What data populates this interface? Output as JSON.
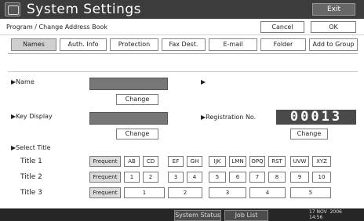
{
  "window": {
    "title": "System Settings",
    "exit_label": "Exit"
  },
  "header": {
    "breadcrumb": "Program / Change Address Book",
    "cancel_label": "Cancel",
    "ok_label": "OK"
  },
  "tabs": [
    "Names",
    "Auth. Info",
    "Protection",
    "Fax Dest.",
    "E-mail",
    "Folder",
    "Add to Group"
  ],
  "form": {
    "name_label": "▶Name",
    "name_change": "Change",
    "right_marker": "▶",
    "key_display_label": "▶Key Display",
    "key_display_change": "Change",
    "registration_label": "▶Registration No.",
    "registration_value": "00013",
    "registration_change": "Change",
    "select_title_label": "▶Select Title"
  },
  "titles": [
    {
      "label": "Title 1",
      "freq": "Frequent",
      "options": [
        "AB",
        "CD",
        "EF",
        "GH",
        "IJK",
        "LMN",
        "OPQ",
        "RST",
        "UVW",
        "XYZ"
      ]
    },
    {
      "label": "Title 2",
      "freq": "Frequent",
      "options": [
        "1",
        "2",
        "3",
        "4",
        "5",
        "6",
        "7",
        "8",
        "9",
        "10"
      ]
    },
    {
      "label": "Title 3",
      "freq": "Frequent",
      "options": [
        "1",
        "2",
        "3",
        "4",
        "5"
      ]
    }
  ],
  "status": {
    "system_status": "System Status",
    "job_list": "Job List",
    "date": "17 NOV  2006",
    "time": "14:56"
  },
  "colors": {
    "titlebar": "#3c3c3c",
    "active_tab": "#cfcfcf",
    "field_dark": "#777777"
  }
}
